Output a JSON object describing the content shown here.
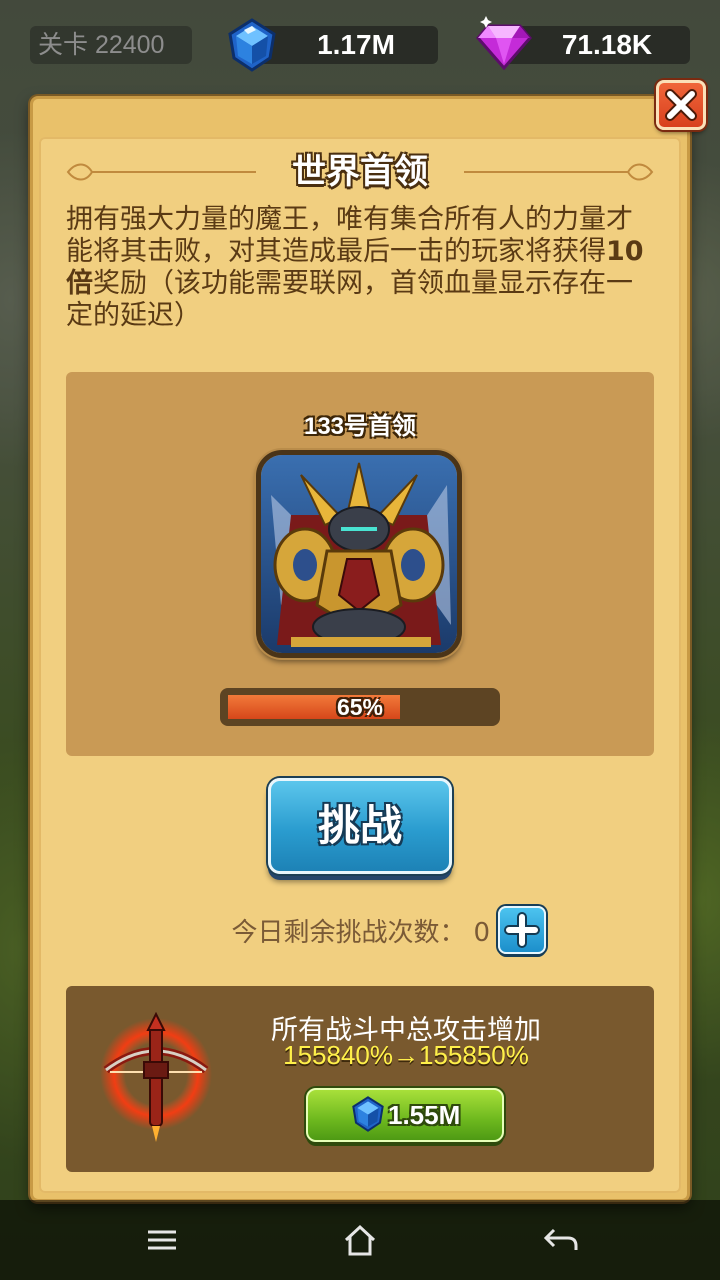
{
  "hud": {
    "level_label": "关卡 22400",
    "blue_gems": "1.17M",
    "pink_gems": "71.18K"
  },
  "dialog": {
    "title": "世界首领",
    "description_part1": "拥有强大力量的魔王，唯有集合所有人的力量才能将其击败，对其造成最后一击的玩家将获得",
    "description_bold": "10倍",
    "description_part2": "奖励（该功能需要联网，首领血量显示存在一定的延迟）",
    "boss": {
      "name": "133号首领",
      "health_percent": 65,
      "health_label": "65%"
    },
    "challenge_button": "挑战",
    "remaining_label": "今日剩余挑战次数：",
    "remaining_count": "0",
    "upgrade": {
      "title": "所有战斗中总攻击增加",
      "values": "155840%→155850%",
      "cost": "1.55M"
    }
  },
  "icons": {
    "close": "close-icon",
    "blue_gem": "blue-gem-icon",
    "pink_gem": "pink-gem-icon",
    "plus": "plus-icon",
    "weapon": "crossbow-icon",
    "nav_menu": "menu-icon",
    "nav_home": "home-icon",
    "nav_back": "back-icon"
  },
  "colors": {
    "dialog_bg": "#f1cf80",
    "boss_panel": "#c99a55",
    "upgrade_panel": "#79592e",
    "health_bar": "#e0572a",
    "challenge_button": "#2a9ccf",
    "cost_button": "#6db81e",
    "upgrade_values": "#fff04a"
  }
}
